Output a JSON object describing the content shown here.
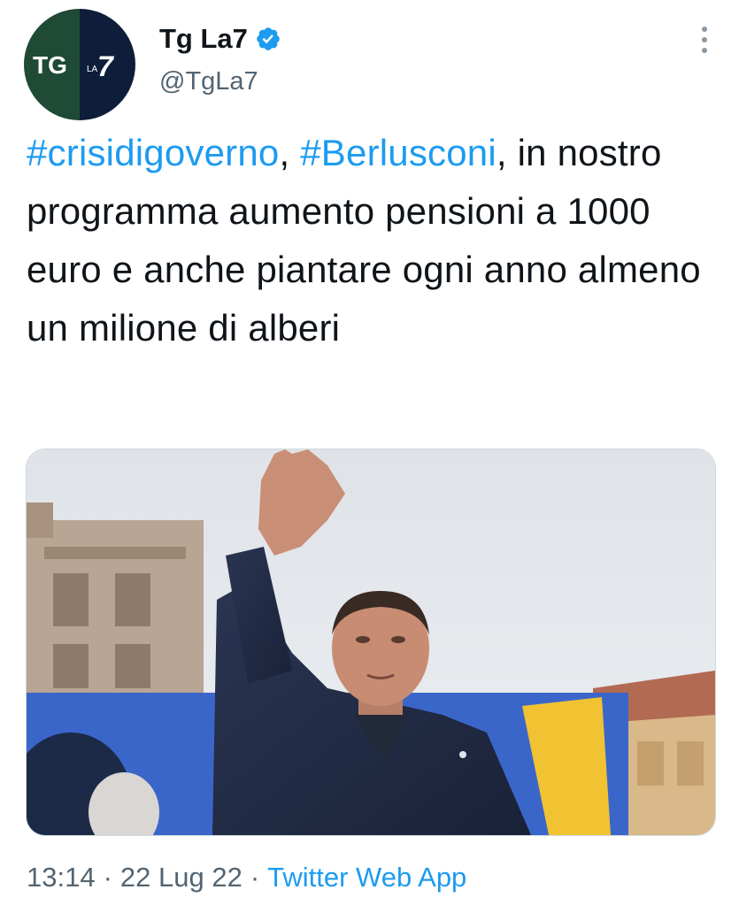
{
  "author": {
    "display_name": "Tg La7",
    "handle": "@TgLa7",
    "verified": true,
    "avatar_icon": "tg-la7-logo",
    "avatar_text_tg": "TG",
    "avatar_text_la": "LA",
    "avatar_text_7": "7",
    "avatar_colors": {
      "left": "#1f4a35",
      "right": "#0e1d3a"
    }
  },
  "tweet": {
    "hashtag_1": "#crisidigoverno",
    "sep_1": ", ",
    "hashtag_2": "#Berlusconi",
    "text_rest": ", in nostro programma aumento pensioni a 1000 euro e anche piantare ogni anno almeno un milione di alberi"
  },
  "media": {
    "kind": "photo"
  },
  "meta": {
    "time": "13:14",
    "separator": "·",
    "date": "22 Lug 22",
    "source": "Twitter Web App"
  },
  "colors": {
    "link": "#1d9bf0",
    "text": "#0f1419",
    "muted": "#536471",
    "verified": "#1d9bf0"
  },
  "icons": [
    "verified-badge-icon",
    "more-options-icon"
  ]
}
